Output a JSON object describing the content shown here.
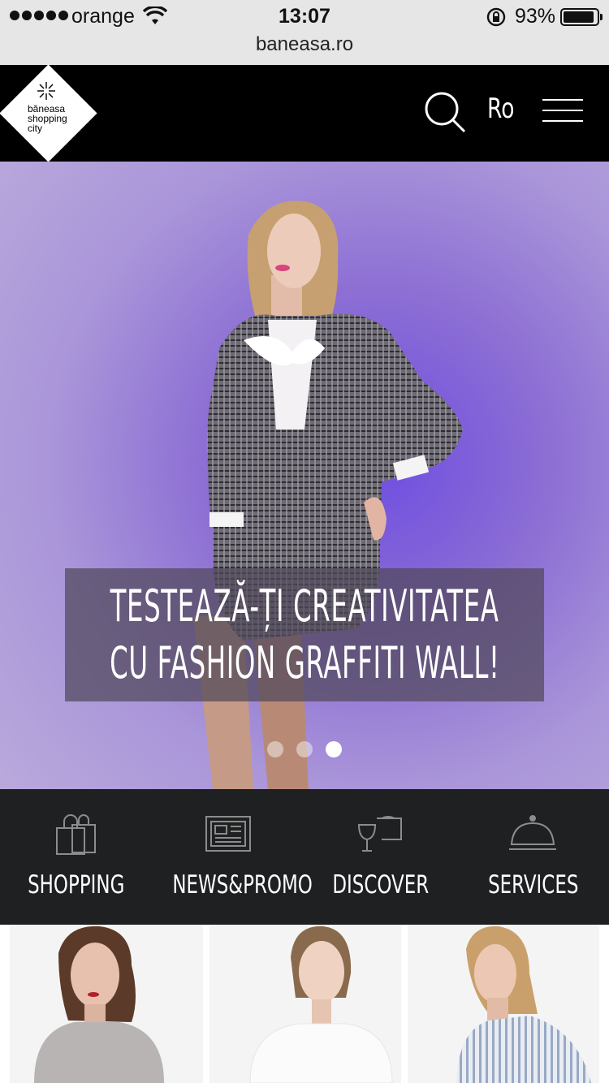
{
  "status_bar": {
    "carrier": "orange",
    "time": "13:07",
    "battery_percent": "93%",
    "battery_level": 0.93,
    "url": "baneasa.ro"
  },
  "header": {
    "logo_lines": [
      "băneasa",
      "shopping",
      "city"
    ],
    "search_icon": "search-icon",
    "language": "Ro",
    "menu_icon": "hamburger-menu-icon",
    "background": "#000000"
  },
  "hero": {
    "caption_line1": "TESTEAZĂ-ȚI CREATIVITATEA",
    "caption_line2": "CU FASHION GRAFFITI WALL!",
    "slides": 3,
    "active_slide": 3,
    "background": "#8d6fd4"
  },
  "categories": [
    {
      "label": "SHOPPING",
      "icon": "shopping-bags-icon"
    },
    {
      "label": "NEWS&PROMO",
      "icon": "newspaper-icon"
    },
    {
      "label": "DISCOVER",
      "icon": "wine-glass-icon"
    },
    {
      "label": "SERVICES",
      "icon": "cloche-icon"
    }
  ],
  "products": [
    {
      "icon": "product-photo-silver-top"
    },
    {
      "icon": "product-photo-white-top"
    },
    {
      "icon": "product-photo-striped-shirt"
    }
  ],
  "colors": {
    "nav_background": "#1f2021",
    "status_bar": "#e6e6e6"
  }
}
